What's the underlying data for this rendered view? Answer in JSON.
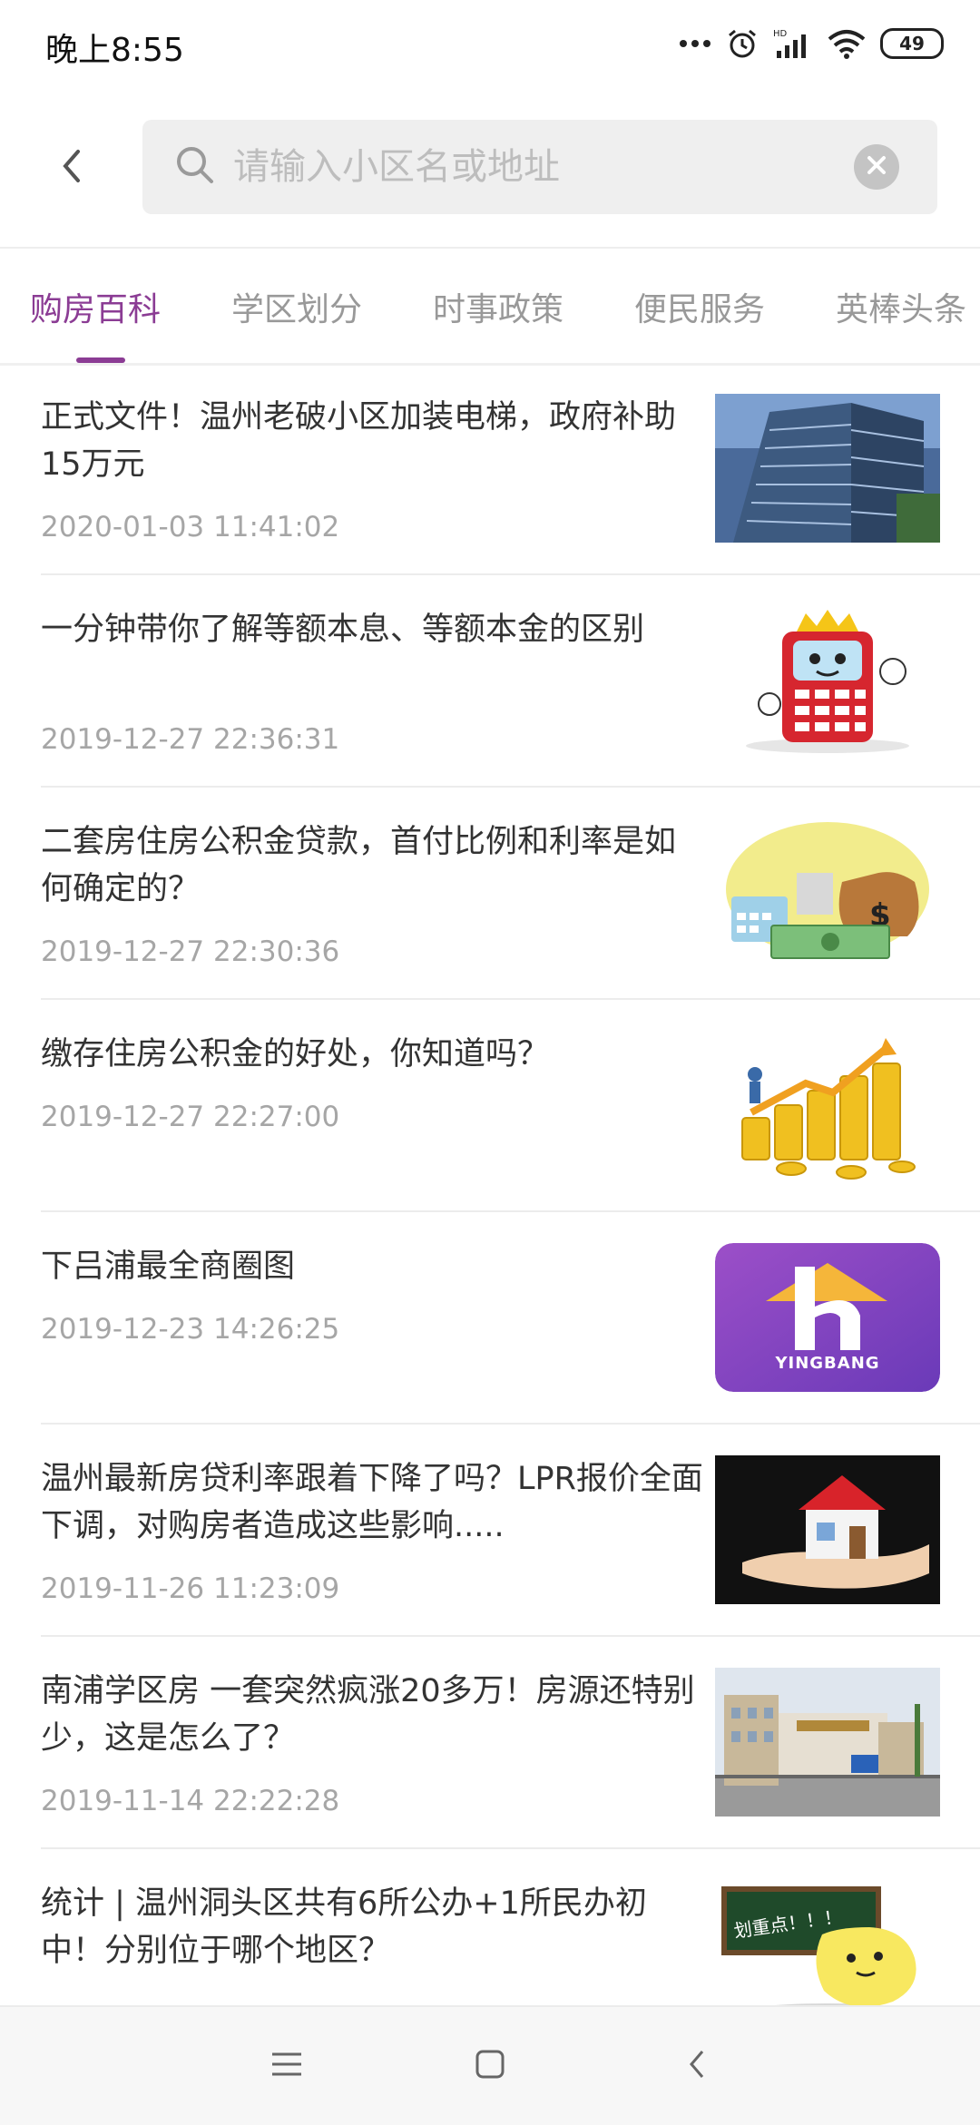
{
  "status_bar": {
    "time": "晚上8:55",
    "battery": "49",
    "icons": [
      "more-dots-icon",
      "alarm-icon",
      "signal-icon",
      "wifi-icon",
      "battery-icon"
    ]
  },
  "header": {
    "back_icon": "chevron-left-icon",
    "search": {
      "placeholder": "请输入小区名或地址",
      "value": ""
    },
    "clear_icon": "clear-circle-icon"
  },
  "tabs": [
    {
      "label": "购房百科",
      "active": true
    },
    {
      "label": "学区划分",
      "active": false
    },
    {
      "label": "时事政策",
      "active": false
    },
    {
      "label": "便民服务",
      "active": false
    },
    {
      "label": "英棒头条",
      "active": false
    }
  ],
  "articles": [
    {
      "title": "正式文件！温州老破小区加装电梯，政府补助15万元",
      "date": "2020-01-03 11:41:02",
      "thumb": "building-photo"
    },
    {
      "title": "一分钟带你了解等额本息、等额本金的区别",
      "date": "2019-12-27 22:36:31",
      "thumb": "calculator-mascot"
    },
    {
      "title": "二套房住房公积金贷款，首付比例和利率是如何确定的？",
      "date": "2019-12-27 22:30:36",
      "thumb": "money-bag"
    },
    {
      "title": "缴存住房公积金的好处，你知道吗？",
      "date": "2019-12-27 22:27:00",
      "thumb": "gold-coins-growth"
    },
    {
      "title": "下吕浦最全商圈图",
      "date": "2019-12-23 14:26:25",
      "thumb": "yingbang-logo"
    },
    {
      "title": "温州最新房贷利率跟着下降了吗？LPR报价全面下调，对购房者造成这些影响.....",
      "date": "2019-11-26 11:23:09",
      "thumb": "house-in-hand"
    },
    {
      "title": "南浦学区房 一套突然疯涨20多万！房源还特别少，这是怎么了？",
      "date": "2019-11-14 22:22:28",
      "thumb": "school-gate-photo"
    },
    {
      "title": "统计 | 温州洞头区共有6所公办+1所民办初中！分别位于哪个地区？",
      "date": "",
      "thumb": "chalkboard-mascot"
    }
  ],
  "logo_text": "YINGBANG",
  "chalkboard_text": "划重点！！！",
  "nav": {
    "menu_icon": "menu-icon",
    "home_icon": "home-square-icon",
    "back_icon": "back-triangle-icon"
  },
  "colors": {
    "accent": "#8b3c94",
    "text": "#333333",
    "muted": "#a6a6a6"
  }
}
